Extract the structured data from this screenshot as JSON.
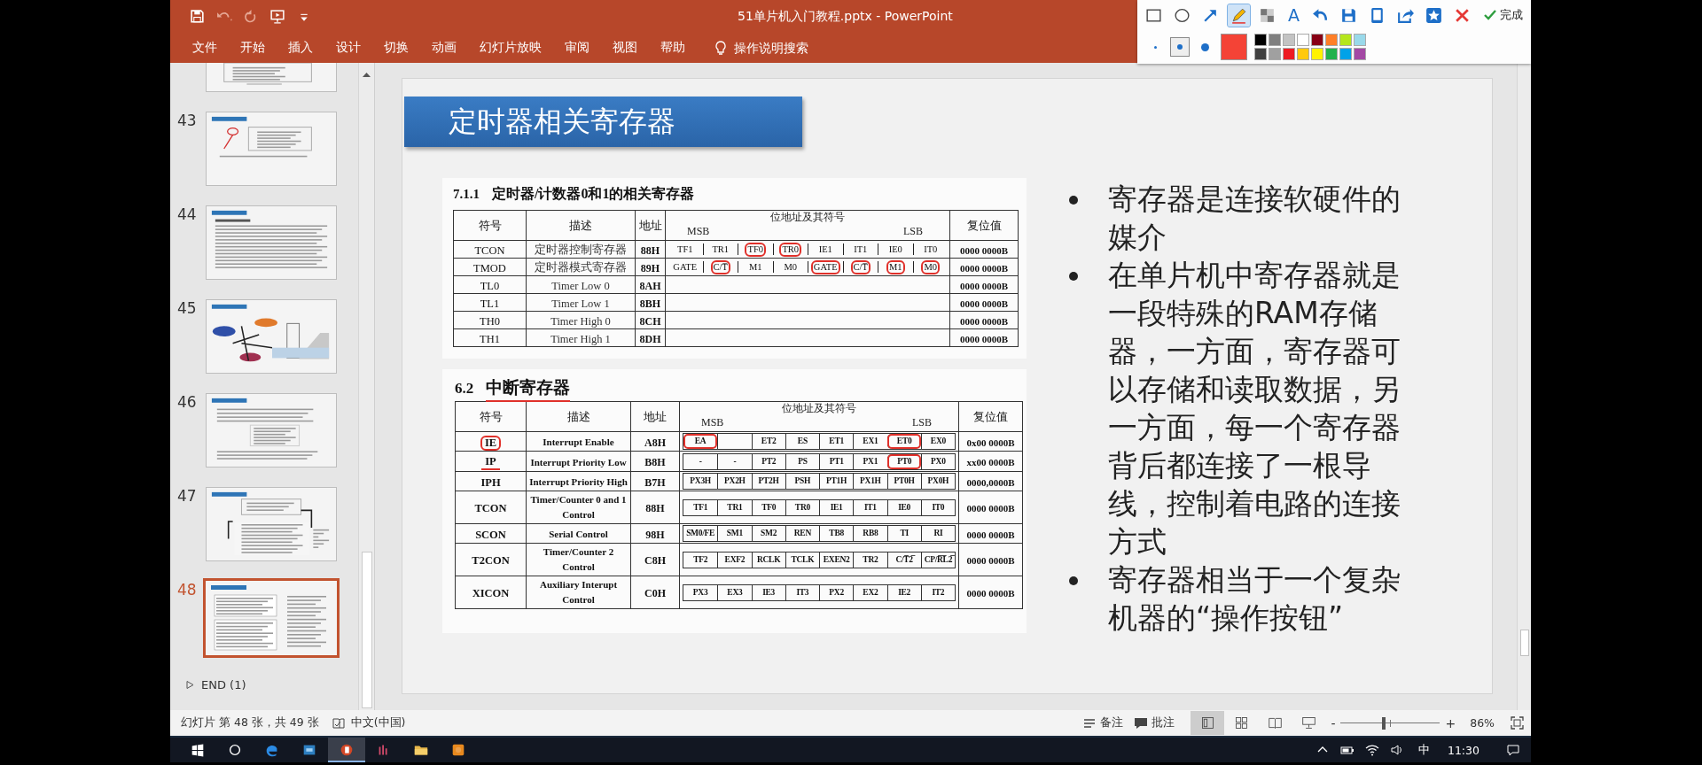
{
  "quick_access": [
    {
      "kind": "save",
      "disabled": false
    },
    {
      "kind": "undo",
      "disabled": true
    },
    {
      "kind": "redo",
      "disabled": true
    },
    {
      "kind": "present",
      "disabled": false
    },
    {
      "kind": "customize",
      "disabled": false
    }
  ],
  "window": {
    "title": "51单片机入门教程.pptx  -  PowerPoint"
  },
  "ribbon_tabs": [
    {
      "label": "文件"
    },
    {
      "label": "开始"
    },
    {
      "label": "插入"
    },
    {
      "label": "设计"
    },
    {
      "label": "切换"
    },
    {
      "label": "动画"
    },
    {
      "label": "幻灯片放映"
    },
    {
      "label": "审阅"
    },
    {
      "label": "视图"
    },
    {
      "label": "帮助"
    }
  ],
  "tell_me": {
    "placeholder": "操作说明搜索"
  },
  "annotation_toolbar": {
    "tools": [
      {
        "kind": "rectangle",
        "selected": false
      },
      {
        "kind": "ellipse",
        "selected": false
      },
      {
        "kind": "arrow",
        "selected": false
      },
      {
        "kind": "pen",
        "selected": true
      },
      {
        "kind": "mosaic",
        "selected": false
      },
      {
        "kind": "text",
        "label": "A",
        "selected": false
      },
      {
        "kind": "undo",
        "selected": false
      },
      {
        "kind": "save",
        "selected": false
      },
      {
        "kind": "pin",
        "selected": false
      },
      {
        "kind": "share",
        "selected": false
      },
      {
        "kind": "star",
        "selected": false
      },
      {
        "kind": "close",
        "selected": false
      }
    ],
    "done": {
      "label": "完成"
    },
    "pen_sizes": [
      {
        "selected": false
      },
      {
        "selected": true
      },
      {
        "selected": false
      }
    ],
    "current_swatch": {
      "color": "#f44336"
    },
    "palette": [
      {
        "color": "#000000"
      },
      {
        "color": "#7f7f7f"
      },
      {
        "color": "#c3c3c3"
      },
      {
        "color": "#ffffff"
      },
      {
        "color": "#880015"
      },
      {
        "color": "#ff7f27"
      },
      {
        "color": "#b5e61d"
      },
      {
        "color": "#99d9ea"
      },
      {
        "color": "#404040"
      },
      {
        "color": "#a0a0a0"
      },
      {
        "color": "#ed1c24"
      },
      {
        "color": "#ffc90e"
      },
      {
        "color": "#fff200"
      },
      {
        "color": "#22b14c"
      },
      {
        "color": "#00a2e8"
      },
      {
        "color": "#a349a4"
      }
    ]
  },
  "thumbnails": [
    {
      "kind": "cut",
      "selected": false
    },
    {
      "number": "43",
      "kind": "diagram",
      "selected": false
    },
    {
      "number": "44",
      "kind": "text",
      "selected": false
    },
    {
      "number": "45",
      "kind": "bubbles",
      "selected": false
    },
    {
      "number": "46",
      "kind": "list",
      "selected": false
    },
    {
      "number": "47",
      "kind": "grid",
      "selected": false
    },
    {
      "number": "48",
      "kind": "tables",
      "selected": true
    }
  ],
  "section": {
    "label": "END (1)",
    "expanded": false
  },
  "slide": {
    "title": "定时器相关寄存器",
    "tables": [
      {
        "kind": "plain",
        "number": "7.1.1",
        "title": "定时器/计数器0和1的相关寄存器",
        "title_underlined": false,
        "columns": [
          "符号",
          "描述",
          "地址",
          "位地址及其符号",
          "复位值"
        ],
        "msb": "MSB",
        "lsb": "LSB",
        "rows": [
          {
            "symbol": "TCON",
            "symbol_circled": false,
            "symbol_underlined": false,
            "description": "定时器控制寄存器",
            "address": "88H",
            "reset": "0000 0000B",
            "bits": [
              {
                "text": "TF1",
                "circled": false
              },
              {
                "text": "TR1",
                "circled": false
              },
              {
                "text": "TF0",
                "circled": true
              },
              {
                "text": "TR0",
                "circled": true
              },
              {
                "text": "IE1",
                "circled": false
              },
              {
                "text": "IT1",
                "circled": false
              },
              {
                "text": "IE0",
                "circled": false
              },
              {
                "text": "IT0",
                "circled": false
              }
            ]
          },
          {
            "symbol": "TMOD",
            "symbol_circled": false,
            "symbol_underlined": false,
            "description": "定时器模式寄存器",
            "address": "89H",
            "reset": "0000 0000B",
            "bits": [
              {
                "text": "GATE",
                "circled": false
              },
              {
                "text": "C/T̅",
                "circled": true
              },
              {
                "text": "M1",
                "circled": false
              },
              {
                "text": "M0",
                "circled": false
              },
              {
                "text": "GATE",
                "circled": true
              },
              {
                "text": "C/T̅",
                "circled": true
              },
              {
                "text": "M1",
                "circled": true
              },
              {
                "text": "M0",
                "circled": true
              }
            ]
          },
          {
            "symbol": "TL0",
            "symbol_circled": false,
            "symbol_underlined": false,
            "description": "Timer Low 0",
            "address": "8AH",
            "reset": "0000 0000B"
          },
          {
            "symbol": "TL1",
            "symbol_circled": false,
            "symbol_underlined": false,
            "description": "Timer Low 1",
            "address": "8BH",
            "reset": "0000 0000B"
          },
          {
            "symbol": "TH0",
            "symbol_circled": false,
            "symbol_underlined": false,
            "description": "Timer High 0",
            "address": "8CH",
            "reset": "0000 0000B"
          },
          {
            "symbol": "TH1",
            "symbol_circled": false,
            "symbol_underlined": false,
            "description": "Timer High 1",
            "address": "8DH",
            "reset": "0000 0000B"
          }
        ]
      },
      {
        "kind": "boxed",
        "number": "6.2",
        "title": "中断寄存器",
        "title_underlined": true,
        "columns": [
          "符号",
          "描述",
          "地址",
          "位地址及其符号",
          "复位值"
        ],
        "msb": "MSB",
        "lsb": "LSB",
        "rows": [
          {
            "symbol": "IE",
            "symbol_circled": true,
            "symbol_underlined": false,
            "description": "Interrupt Enable",
            "address": "A8H",
            "reset": "0x00 0000B",
            "bits": [
              {
                "text": "EA",
                "circled": true
              },
              {
                "circled": false
              },
              {
                "text": "ET2",
                "circled": false
              },
              {
                "text": "ES",
                "circled": false
              },
              {
                "text": "ET1",
                "circled": false
              },
              {
                "text": "EX1",
                "circled": false
              },
              {
                "text": "ET0",
                "circled": true
              },
              {
                "text": "EX0",
                "circled": false
              }
            ]
          },
          {
            "symbol": "IP",
            "symbol_circled": false,
            "symbol_underlined": true,
            "description": "Interrupt Priority Low",
            "address": "B8H",
            "reset": "xx00 0000B",
            "bits": [
              {
                "text": "-",
                "circled": false
              },
              {
                "text": "-",
                "circled": false
              },
              {
                "text": "PT2",
                "circled": false
              },
              {
                "text": "PS",
                "circled": false
              },
              {
                "text": "PT1",
                "circled": false
              },
              {
                "text": "PX1",
                "circled": false
              },
              {
                "text": "PT0",
                "circled": true
              },
              {
                "text": "PX0",
                "circled": false
              }
            ]
          },
          {
            "symbol": "IPH",
            "symbol_circled": false,
            "symbol_underlined": false,
            "description": "Interrupt Priority High",
            "address": "B7H",
            "reset": "0000,0000B",
            "bits": [
              {
                "text": "PX3H",
                "circled": false
              },
              {
                "text": "PX2H",
                "circled": false
              },
              {
                "text": "PT2H",
                "circled": false
              },
              {
                "text": "PSH",
                "circled": false
              },
              {
                "text": "PT1H",
                "circled": false
              },
              {
                "text": "PX1H",
                "circled": false
              },
              {
                "text": "PT0H",
                "circled": false
              },
              {
                "text": "PX0H",
                "circled": false
              }
            ]
          },
          {
            "symbol": "TCON",
            "symbol_circled": false,
            "symbol_underlined": false,
            "description": "Timer/Counter 0 and 1 Control",
            "address": "88H",
            "reset": "0000 0000B",
            "bits": [
              {
                "text": "TF1",
                "circled": false
              },
              {
                "text": "TR1",
                "circled": false
              },
              {
                "text": "TF0",
                "circled": false
              },
              {
                "text": "TR0",
                "circled": false
              },
              {
                "text": "IE1",
                "circled": false
              },
              {
                "text": "IT1",
                "circled": false
              },
              {
                "text": "IE0",
                "circled": false
              },
              {
                "text": "IT0",
                "circled": false
              }
            ]
          },
          {
            "symbol": "SCON",
            "symbol_circled": false,
            "symbol_underlined": false,
            "description": "Serial Control",
            "address": "98H",
            "reset": "0000 0000B",
            "bits": [
              {
                "text": "SM0/FE",
                "circled": false
              },
              {
                "text": "SM1",
                "circled": false
              },
              {
                "text": "SM2",
                "circled": false
              },
              {
                "text": "REN",
                "circled": false
              },
              {
                "text": "TB8",
                "circled": false
              },
              {
                "text": "RB8",
                "circled": false
              },
              {
                "text": "TI",
                "circled": false
              },
              {
                "text": "RI",
                "circled": false
              }
            ]
          },
          {
            "symbol": "T2CON",
            "symbol_circled": false,
            "symbol_underlined": false,
            "description": "Timer/Counter 2 Control",
            "address": "C8H",
            "reset": "0000 0000B",
            "bits": [
              {
                "text": "TF2",
                "circled": false
              },
              {
                "text": "EXF2",
                "circled": false
              },
              {
                "text": "RCLK",
                "circled": false
              },
              {
                "text": "TCLK",
                "circled": false
              },
              {
                "text": "EXEN2",
                "circled": false
              },
              {
                "text": "TR2",
                "circled": false
              },
              {
                "text": "C/T̅2̅",
                "circled": false
              },
              {
                "text": "CP/R̅L̅2̅",
                "circled": false
              }
            ]
          },
          {
            "symbol": "XICON",
            "symbol_circled": false,
            "symbol_underlined": false,
            "description": "Auxiliary Interupt Control",
            "address": "C0H",
            "reset": "0000 0000B",
            "bits": [
              {
                "text": "PX3",
                "circled": false
              },
              {
                "text": "EX3",
                "circled": false
              },
              {
                "text": "IE3",
                "circled": false
              },
              {
                "text": "IT3",
                "circled": false
              },
              {
                "text": "PX2",
                "circled": false
              },
              {
                "text": "EX2",
                "circled": false
              },
              {
                "text": "IE2",
                "circled": false
              },
              {
                "text": "IT2",
                "circled": false
              }
            ]
          }
        ]
      }
    ],
    "bullets": [
      "寄存器是连接软硬件的媒介",
      "在单片机中寄存器就是一段特殊的RAM存储器，一方面，寄存器可以存储和读取数据，另一方面，每一个寄存器背后都连接了一根导线，控制着电路的连接方式",
      "寄存器相当于一个复杂机器的“操作按钮”"
    ]
  },
  "status_bar": {
    "slide_info": "幻灯片 第 48 张，共 49 张",
    "language": "中文(中国)",
    "notes": "备注",
    "comments": "批注",
    "views": [
      {
        "kind": "normal",
        "selected": true
      },
      {
        "kind": "sorter",
        "selected": false
      },
      {
        "kind": "reading",
        "selected": false
      },
      {
        "kind": "slideshow",
        "selected": false
      }
    ],
    "zoom_minus": "-",
    "zoom_plus": "+",
    "zoom": {
      "level": 0.43
    },
    "zoom_percent": "86%"
  },
  "taskbar": {
    "apps": [
      {
        "kind": "start",
        "active": false
      },
      {
        "kind": "search",
        "active": false
      },
      {
        "kind": "browser",
        "active": false
      },
      {
        "kind": "tile",
        "active": false
      },
      {
        "kind": "powerpoint",
        "active": true
      },
      {
        "kind": "media",
        "active": false
      },
      {
        "kind": "folder",
        "active": false
      },
      {
        "kind": "orange",
        "active": false
      }
    ],
    "ime": "中",
    "time": "11:30"
  }
}
